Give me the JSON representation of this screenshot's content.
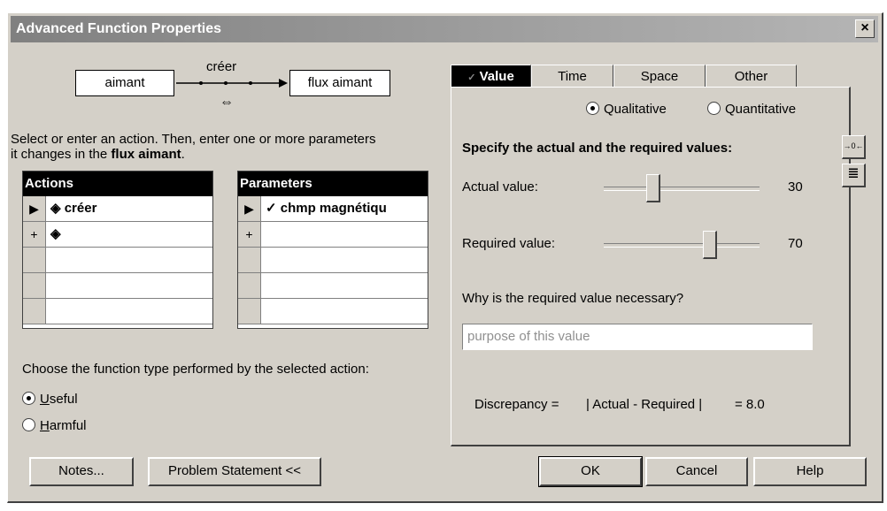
{
  "window": {
    "title": "Advanced Function Properties",
    "close_label": "×"
  },
  "diagram": {
    "source": "aimant",
    "action": "créer",
    "target": "flux aimant",
    "swap_glyph": "⇔"
  },
  "instructions": {
    "line1": "Select or enter an action. Then, enter one or more parameters",
    "line2_pre": "it changes in the ",
    "line2_bold": "flux aimant",
    "line2_post": "."
  },
  "actions_grid": {
    "header": "Actions",
    "rows": [
      {
        "selector": "▶",
        "text": "◈ créer"
      },
      {
        "selector": "+",
        "text": "◈"
      },
      {
        "selector": "",
        "text": ""
      },
      {
        "selector": "",
        "text": ""
      },
      {
        "selector": "",
        "text": ""
      }
    ]
  },
  "parameters_grid": {
    "header": "Parameters",
    "rows": [
      {
        "selector": "▶",
        "text": "✓ chmp magnétiqu"
      },
      {
        "selector": "+",
        "text": ""
      },
      {
        "selector": "",
        "text": ""
      },
      {
        "selector": "",
        "text": ""
      },
      {
        "selector": "",
        "text": ""
      }
    ]
  },
  "function_type": {
    "prompt": "Choose the function type performed by the selected action:",
    "options": [
      {
        "label_u": "U",
        "label_rest": "seful",
        "selected": true
      },
      {
        "label_u": "H",
        "label_rest": "armful",
        "selected": false
      }
    ]
  },
  "tabs": [
    {
      "label": "Value",
      "active": true,
      "icon": "check-icon"
    },
    {
      "label": "Time",
      "active": false
    },
    {
      "label": "Space",
      "active": false
    },
    {
      "label": "Other",
      "active": false
    }
  ],
  "value_tab": {
    "mode_options": [
      {
        "label": "Qualitative",
        "selected": true
      },
      {
        "label": "Quantitative",
        "selected": false
      }
    ],
    "heading": "Specify the actual and the required values:",
    "actual": {
      "label": "Actual value:",
      "value": "30",
      "level": 0.3
    },
    "required": {
      "label": "Required value:",
      "value": "70",
      "level": 0.7
    },
    "why_label": "Why is the required value necessary?",
    "purpose_placeholder": "purpose of this value",
    "discrepancy_label": "Discrepancy =",
    "discrepancy_formula": "| Actual - Required |",
    "discrepancy_result": "= 8.0"
  },
  "side_buttons": {
    "pin_glyph": "→0←",
    "notes_glyph": "≣"
  },
  "buttons": {
    "notes": "Notes...",
    "problem_statement": "Problem Statement <<",
    "ok": "OK",
    "cancel": "Cancel",
    "help": "Help"
  }
}
